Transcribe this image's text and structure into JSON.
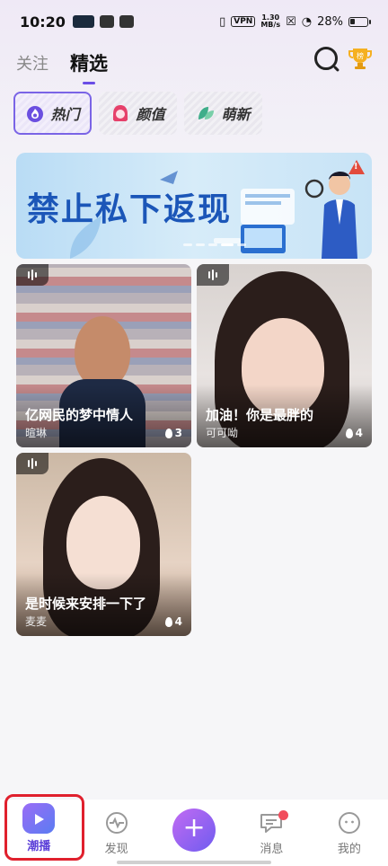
{
  "status_bar": {
    "time": "10:20",
    "vpn": "VPN",
    "speed_value": "1.30",
    "speed_unit": "MB/s",
    "battery": "28%"
  },
  "header": {
    "tabs": [
      {
        "label": "关注",
        "active": false
      },
      {
        "label": "精选",
        "active": true
      }
    ],
    "rank_icon_text": "榜"
  },
  "categories": [
    {
      "label": "热门",
      "icon": "flame-icon",
      "color": "#6b4fe0",
      "active": true
    },
    {
      "label": "颜值",
      "icon": "girl-icon",
      "color": "#e6406a",
      "active": false
    },
    {
      "label": "萌新",
      "icon": "leaf-icon",
      "color": "#3fae8a",
      "active": false
    }
  ],
  "banner": {
    "title": "禁止私下返现"
  },
  "cards": [
    {
      "title": "亿网民的梦中情人",
      "name": "暄琳",
      "heat": "3"
    },
    {
      "title": "加油！你是最胖的",
      "name": "可可呦",
      "heat": "4"
    },
    {
      "title": "是时候来安排一下了",
      "name": "麦麦",
      "heat": "4"
    }
  ],
  "bottom_nav": {
    "items": [
      {
        "label": "潮播",
        "icon": "tv-icon",
        "active": true
      },
      {
        "label": "发现",
        "icon": "pulse-icon",
        "active": false
      },
      {
        "label": "",
        "icon": "plus-icon",
        "active": false
      },
      {
        "label": "消息",
        "icon": "chat-icon",
        "active": false
      },
      {
        "label": "我的",
        "icon": "profile-icon",
        "active": false
      }
    ],
    "plus_symbol": "+"
  }
}
